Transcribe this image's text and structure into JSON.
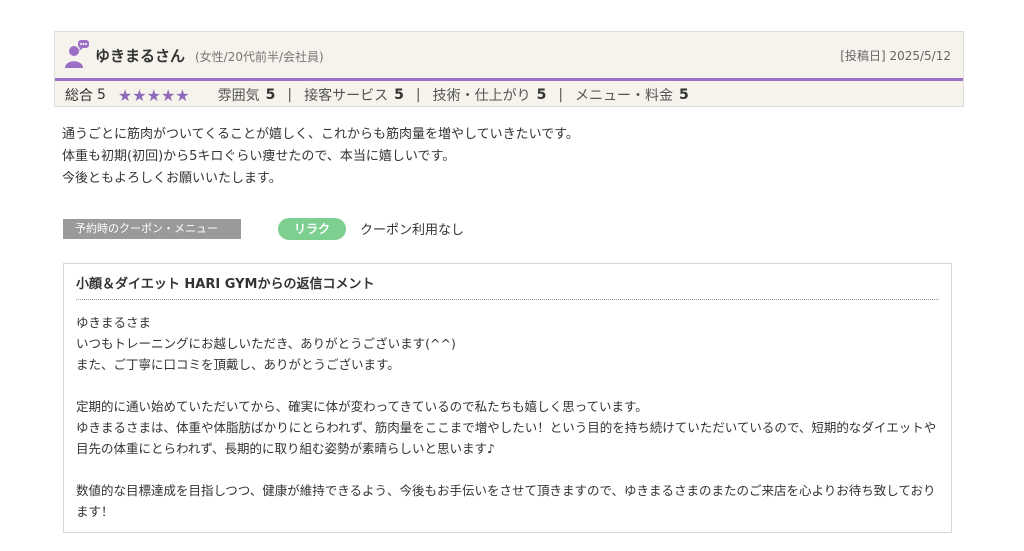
{
  "reviewer": {
    "name": "ゆきまるさん",
    "meta": "(女性/20代前半/会社員)",
    "post_date": "[投稿日] 2025/5/12"
  },
  "ratings": {
    "overall_label": "総合",
    "overall_value": "5",
    "stars": "★★★★★",
    "items": [
      {
        "label": "雰囲気",
        "value": "5"
      },
      {
        "label": "接客サービス",
        "value": "5"
      },
      {
        "label": "技術・仕上がり",
        "value": "5"
      },
      {
        "label": "メニュー・料金",
        "value": "5"
      }
    ],
    "separator": "|"
  },
  "review_body": [
    "通うごとに筋肉がついてくることが嬉しく、これからも筋肉量を増やしていきたいです。",
    "体重も初期(初回)から5キロぐらい痩せたので、本当に嬉しいです。",
    "今後ともよろしくお願いいたします。"
  ],
  "coupon": {
    "label": "予約時のクーポン・メニュー",
    "badge": "リラク",
    "value": "クーポン利用なし"
  },
  "reply": {
    "title": "小顔＆ダイエット HARI GYMからの返信コメント",
    "paragraphs": [
      [
        "ゆきまるさま",
        "いつもトレーニングにお越しいただき、ありがとうございます(^^)",
        "また、ご丁寧に口コミを頂戴し、ありがとうございます。"
      ],
      [
        "定期的に通い始めていただいてから、確実に体が変わってきているので私たちも嬉しく思っています。",
        "ゆきまるさまは、体重や体脂肪ばかりにとらわれず、筋肉量をここまで増やしたい！という目的を持ち続けていただいているので、短期的なダイエットや目先の体重にとらわれず、長期的に取り組む姿勢が素晴らしいと思います♪"
      ],
      [
        "数値的な目標達成を目指しつつ、健康が維持できるよう、今後もお手伝いをさせて頂きますので、ゆきまるさまのまたのご来店を心よりお待ち致しております！"
      ]
    ]
  },
  "colors": {
    "accent": "#9b6fc6",
    "star": "#8e6ab9",
    "badge": "#7ccf8f"
  }
}
